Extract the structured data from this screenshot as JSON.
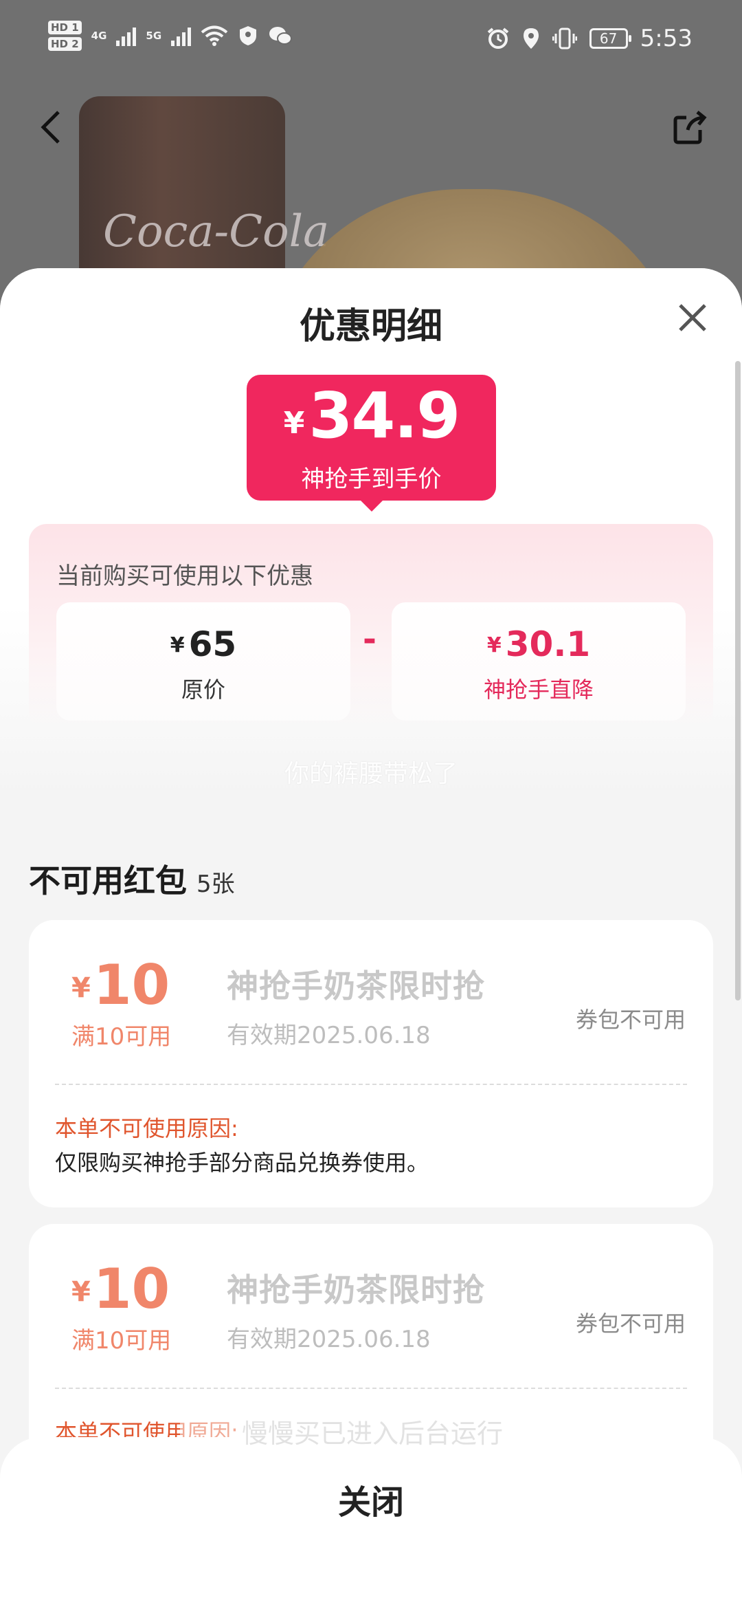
{
  "status_bar": {
    "hd1": "HD 1",
    "hd2": "HD 2",
    "net1": "4G",
    "net2": "5G",
    "battery": "67",
    "time": "5:53",
    "icons": [
      "wifi-icon",
      "shield-icon",
      "wechat-icon",
      "alarm-icon",
      "location-icon",
      "vibrate-icon",
      "battery-icon"
    ]
  },
  "background": {
    "brand_text": "Coca-Cola"
  },
  "sheet": {
    "title": "优惠明细",
    "final_price": {
      "currency": "¥",
      "value": "34.9",
      "label": "神抢手到手价",
      "color": "#f0275e"
    },
    "discount_section": {
      "title": "当前购买可使用以下优惠",
      "operator": "-",
      "items": [
        {
          "currency": "¥",
          "amount": "65",
          "label": "原价"
        },
        {
          "currency": "¥",
          "amount": "30.1",
          "label": "神抢手直降"
        }
      ]
    },
    "faded_toast": "你的裤腰带松了",
    "unavailable": {
      "title": "不可用红包",
      "count": "5张",
      "coupons": [
        {
          "currency": "¥",
          "amount": "10",
          "condition": "满10可用",
          "name": "神抢手奶茶限时抢",
          "expiry": "有效期2025.06.18",
          "status": "券包不可用",
          "reason_title": "本单不可使用原因:",
          "reason": "仅限购买神抢手部分商品兑换券使用。"
        },
        {
          "currency": "¥",
          "amount": "10",
          "condition": "满10可用",
          "name": "神抢手奶茶限时抢",
          "expiry": "有效期2025.06.18",
          "status": "券包不可用",
          "reason_title": "本单不可使用原因:",
          "reason": ""
        }
      ]
    },
    "close_label": "关闭",
    "background_toast": "慢慢买已进入后台运行"
  }
}
